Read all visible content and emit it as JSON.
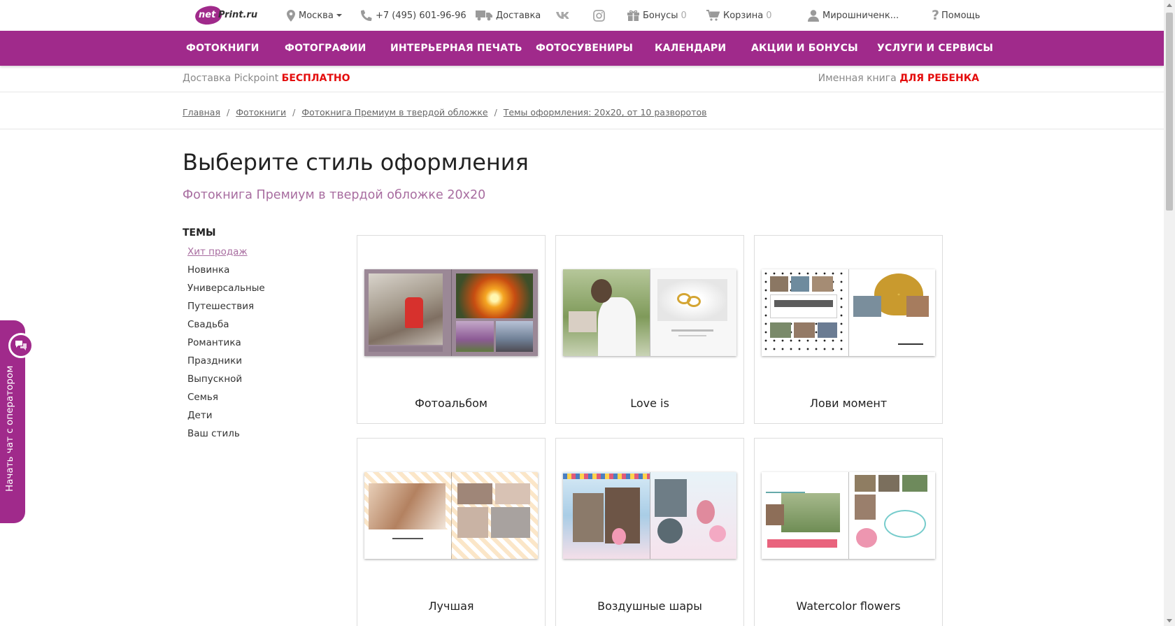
{
  "topbar": {
    "logo_net": "net",
    "logo_rest": "Print.ru",
    "city": "Москва",
    "phone": "+7 (495) 601-96-96",
    "delivery": "Доставка",
    "vk": "vk",
    "bonuses": "Бонусы",
    "bonuses_count": "0",
    "cart": "Корзина",
    "cart_count": "0",
    "user": "Мирошниченк...",
    "help": "Помощь"
  },
  "nav": [
    "ФОТОКНИГИ",
    "ФОТОГРАФИИ",
    "ИНТЕРЬЕРНАЯ ПЕЧАТЬ",
    "ФОТОСУВЕНИРЫ",
    "КАЛЕНДАРИ",
    "АКЦИИ И БОНУСЫ",
    "УСЛУГИ И СЕРВИСЫ"
  ],
  "promo": {
    "left_text": "Доставка Pickpoint",
    "left_accent": "БЕСПЛАТНО",
    "right_text": "Именная книга",
    "right_accent": "ДЛЯ РЕБЕНКА"
  },
  "breadcrumbs": [
    "Главная",
    "Фотокниги",
    "Фотокнига Премиум в твердой обложке",
    "Темы оформления: 20x20, от 10 разворотов"
  ],
  "page": {
    "title": "Выберите стиль оформления",
    "subtitle": "Фотокнига Премиум в твердой обложке 20x20"
  },
  "sidebar": {
    "title": "ТЕМЫ",
    "items": [
      "Хит продаж",
      "Новинка",
      "Универсальные",
      "Путешествия",
      "Свадьба",
      "Романтика",
      "Праздники",
      "Выпускной",
      "Семья",
      "Дети",
      "Ваш стиль"
    ],
    "active_index": 0
  },
  "cards": [
    {
      "title": "Фотоальбом"
    },
    {
      "title": "Love is"
    },
    {
      "title": "Лови момент"
    },
    {
      "title": "Лучшая"
    },
    {
      "title": "Воздушные шары"
    },
    {
      "title": "Watercolor flowers"
    }
  ],
  "chat": {
    "label": "Начать чат с оператором"
  },
  "colors": {
    "brand": "#a02a8b",
    "accent_red": "#e40d0d",
    "subtitle": "#a86da0"
  }
}
